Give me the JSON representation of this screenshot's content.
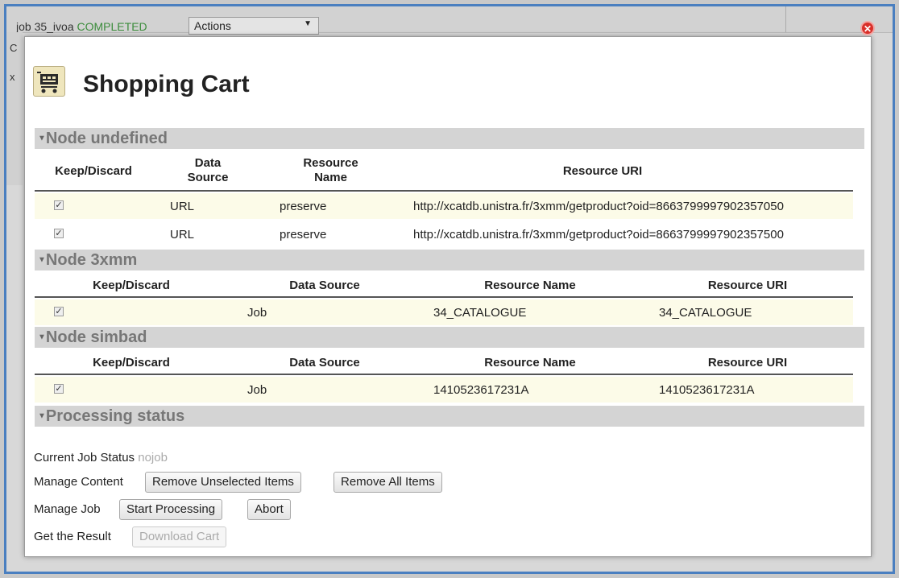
{
  "background": {
    "job_label": "job 35_ivoa",
    "job_status": "COMPLETED",
    "actions_select": "Actions",
    "side_letters": [
      "C",
      "x"
    ]
  },
  "dialog": {
    "title": "Shopping Cart",
    "close_icon": "close-icon",
    "cart_icon": "shopping-cart-icon"
  },
  "sections": [
    {
      "title": "Node undefined",
      "headers": [
        "Keep/Discard",
        "Data Source",
        "Resource Name",
        "Resource URI"
      ],
      "rows": [
        {
          "checked": true,
          "source": "URL",
          "name": "preserve",
          "uri": "http://xcatdb.unistra.fr/3xmm/getproduct?oid=8663799997902357050"
        },
        {
          "checked": true,
          "source": "URL",
          "name": "preserve",
          "uri": "http://xcatdb.unistra.fr/3xmm/getproduct?oid=8663799997902357500"
        }
      ]
    },
    {
      "title": "Node 3xmm",
      "headers": [
        "Keep/Discard",
        "Data Source",
        "Resource Name",
        "Resource URI"
      ],
      "rows": [
        {
          "checked": true,
          "source": "Job",
          "name": "34_CATALOGUE",
          "uri": "34_CATALOGUE"
        }
      ]
    },
    {
      "title": "Node simbad",
      "headers": [
        "Keep/Discard",
        "Data Source",
        "Resource Name",
        "Resource URI"
      ],
      "rows": [
        {
          "checked": true,
          "source": "Job",
          "name": "1410523617231A",
          "uri": "1410523617231A"
        }
      ]
    },
    {
      "title": "Processing status"
    }
  ],
  "controls": {
    "current_job_status_label": "Current Job Status",
    "current_job_status_value": "nojob",
    "manage_content_label": "Manage Content",
    "remove_unselected": "Remove Unselected Items",
    "remove_all": "Remove All Items",
    "manage_job_label": "Manage Job",
    "start_processing": "Start Processing",
    "abort": "Abort",
    "get_result_label": "Get the Result",
    "download_cart": "Download Cart"
  },
  "colors": {
    "accent_border": "#4a7fc0",
    "status_green": "#3c8c3c",
    "section_bg": "#d4d4d4",
    "row_bg": "#fcfbe8"
  }
}
